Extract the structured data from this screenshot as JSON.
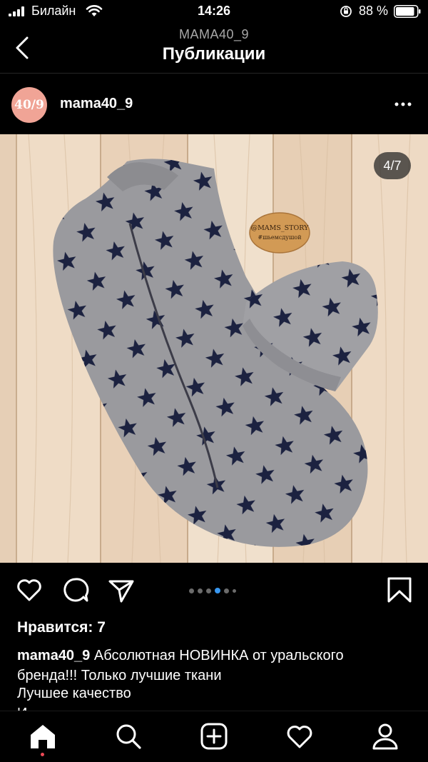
{
  "status_bar": {
    "carrier": "Билайн",
    "time": "14:26",
    "battery_pct": "88 %",
    "battery_level": 0.88
  },
  "nav": {
    "subtitle": "MAMA40_9",
    "title": "Публикации"
  },
  "post": {
    "avatar_text": "40/9",
    "username": "mama40_9",
    "image_counter": "4/7",
    "wood_sign_line1": "@MAMS_STORY",
    "wood_sign_line2": "#шьемсдушой",
    "carousel_total": 6,
    "carousel_active_index": 3,
    "likes": "Нравится: 7",
    "caption_user": "mama40_9",
    "caption_line1": " Абсолютная НОВИНКА от уральского",
    "caption_line2": "бренда!!! Только лучшие ткани",
    "caption_line3": "Лучшее качество",
    "caption_line4": "И"
  },
  "icons": {
    "back": "chevron-left-icon",
    "more": "more-horizontal-icon",
    "like": "heart-icon",
    "comment": "comment-icon",
    "share": "send-icon",
    "save": "bookmark-icon",
    "tabs": [
      "home-icon",
      "search-icon",
      "add-post-icon",
      "activity-heart-icon",
      "profile-icon"
    ]
  },
  "colors": {
    "accent": "#3897f0",
    "avatar_bg": "#f0a496",
    "notification": "#ed4956"
  }
}
